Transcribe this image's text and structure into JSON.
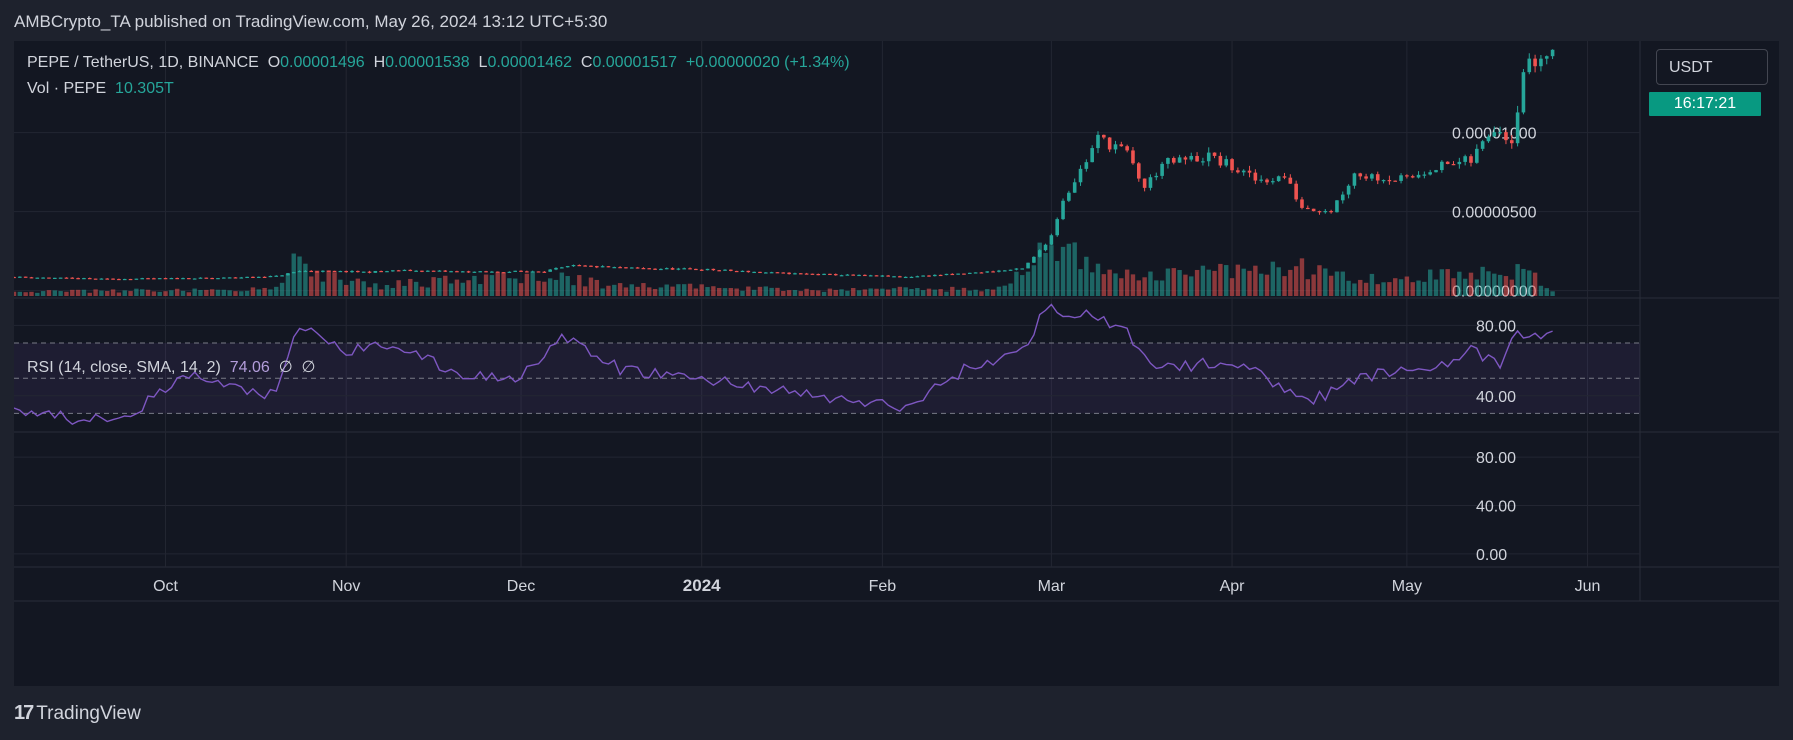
{
  "header": {
    "published": "AMBCrypto_TA published on TradingView.com, May 26, 2024 13:12 UTC+5:30"
  },
  "legend": {
    "symbol": "PEPE / TetherUS, 1D, BINANCE",
    "o_label": "O",
    "o_value": "0.00001496",
    "h_label": "H",
    "h_value": "0.00001538",
    "l_label": "L",
    "l_value": "0.00001462",
    "c_label": "C",
    "c_value": "0.00001517",
    "change": "+0.00000020 (+1.34%)",
    "vol_label": "Vol · PEPE",
    "vol_value": "10.305T",
    "rsi_label": "RSI (14, close, SMA, 14, 2)",
    "rsi_value": "74.06",
    "rsi_extra1": "∅",
    "rsi_extra2": "∅"
  },
  "price_scale": {
    "currency": "USDT",
    "countdown": "16:17:21"
  },
  "footer": {
    "brand": "TradingView"
  },
  "colors": {
    "up": "#26a69a",
    "down": "#ef5350",
    "rsi_line": "#7e57c2",
    "rsi_band": "#7e57c2",
    "text": "#d1d4dc",
    "grid": "#232632",
    "pane_border": "#2a2e39"
  },
  "chart_data": [
    {
      "type": "candlestick",
      "title": "PEPE / TetherUS, 1D, BINANCE",
      "x_ticks": [
        "Oct",
        "Nov",
        "Dec",
        "2024",
        "Feb",
        "Mar",
        "Apr",
        "May",
        "Jun"
      ],
      "y_ticks": [
        "0.00001000",
        "0.00000500",
        "0.00000000"
      ],
      "ylim": [
        -4e-07,
        1.58e-05
      ],
      "x_range": [
        "2023-09-05",
        "2024-06-10"
      ],
      "series": [
        {
          "name": "PEPE",
          "knots": [
            [
              "2023-09-05",
              8.7e-07
            ],
            [
              "2023-09-20",
              7.4e-07
            ],
            [
              "2023-10-10",
              8e-07
            ],
            [
              "2023-10-20",
              9.2e-07
            ],
            [
              "2023-10-24",
              1.25e-06
            ],
            [
              "2023-11-05",
              1.18e-06
            ],
            [
              "2023-11-10",
              1.28e-06
            ],
            [
              "2023-11-25",
              1.18e-06
            ],
            [
              "2023-12-05",
              1.25e-06
            ],
            [
              "2023-12-10",
              1.57e-06
            ],
            [
              "2023-12-20",
              1.42e-06
            ],
            [
              "2024-01-01",
              1.35e-06
            ],
            [
              "2024-01-15",
              1.1e-06
            ],
            [
              "2024-02-05",
              8.8e-07
            ],
            [
              "2024-02-15",
              1.08e-06
            ],
            [
              "2024-02-25",
              1.38e-06
            ],
            [
              "2024-02-27",
              2.1e-06
            ],
            [
              "2024-03-01",
              3.5e-06
            ],
            [
              "2024-03-03",
              5.8e-06
            ],
            [
              "2024-03-06",
              7.6e-06
            ],
            [
              "2024-03-09",
              9.6e-06
            ],
            [
              "2024-03-12",
              9.2e-06
            ],
            [
              "2024-03-14",
              8.6e-06
            ],
            [
              "2024-03-17",
              6.5e-06
            ],
            [
              "2024-03-20",
              8e-06
            ],
            [
              "2024-03-28",
              8.5e-06
            ],
            [
              "2024-04-01",
              7.8e-06
            ],
            [
              "2024-04-05",
              7e-06
            ],
            [
              "2024-04-10",
              7.2e-06
            ],
            [
              "2024-04-13",
              5.3e-06
            ],
            [
              "2024-04-18",
              5.1e-06
            ],
            [
              "2024-04-22",
              7.4e-06
            ],
            [
              "2024-05-01",
              7e-06
            ],
            [
              "2024-05-05",
              7.8e-06
            ],
            [
              "2024-05-12",
              8.2e-06
            ],
            [
              "2024-05-16",
              1.05e-05
            ],
            [
              "2024-05-19",
              9.6e-06
            ],
            [
              "2024-05-21",
              1.4e-05
            ],
            [
              "2024-05-24",
              1.47e-05
            ],
            [
              "2024-05-26",
              1.517e-05
            ]
          ]
        }
      ]
    },
    {
      "type": "bar",
      "title": "Vol · PEPE",
      "values_note": "volume bars scale relative to the pane",
      "knots": [
        [
          "2023-09-05",
          0.08
        ],
        [
          "2023-10-20",
          0.12
        ],
        [
          "2023-10-23",
          0.55
        ],
        [
          "2023-11-05",
          0.18
        ],
        [
          "2023-12-06",
          0.38
        ],
        [
          "2023-12-15",
          0.2
        ],
        [
          "2024-01-15",
          0.12
        ],
        [
          "2024-02-20",
          0.12
        ],
        [
          "2024-02-26",
          0.5
        ],
        [
          "2024-03-01",
          1.0
        ],
        [
          "2024-03-08",
          0.6
        ],
        [
          "2024-03-15",
          0.35
        ],
        [
          "2024-04-13",
          0.5
        ],
        [
          "2024-04-25",
          0.3
        ],
        [
          "2024-05-21",
          0.45
        ],
        [
          "2024-05-26",
          0.08
        ]
      ]
    },
    {
      "type": "line",
      "title": "RSI (14, close, SMA, 14, 2)",
      "y_ticks": [
        "80.00",
        "40.00"
      ],
      "ylim": [
        20,
        95
      ],
      "bands": [
        30,
        50,
        70
      ],
      "series": [
        {
          "name": "RSI",
          "knots": [
            [
              "2023-09-05",
              33
            ],
            [
              "2023-09-15",
              27
            ],
            [
              "2023-09-25",
              30
            ],
            [
              "2023-10-05",
              52
            ],
            [
              "2023-10-12",
              45
            ],
            [
              "2023-10-20",
              40
            ],
            [
              "2023-10-24",
              80
            ],
            [
              "2023-11-01",
              65
            ],
            [
              "2023-11-09",
              70
            ],
            [
              "2023-11-20",
              52
            ],
            [
              "2023-11-30",
              50
            ],
            [
              "2023-12-08",
              73
            ],
            [
              "2023-12-18",
              55
            ],
            [
              "2024-01-05",
              48
            ],
            [
              "2024-01-20",
              40
            ],
            [
              "2024-02-05",
              33
            ],
            [
              "2024-02-15",
              55
            ],
            [
              "2024-02-25",
              65
            ],
            [
              "2024-02-29",
              90
            ],
            [
              "2024-03-08",
              85
            ],
            [
              "2024-03-14",
              75
            ],
            [
              "2024-03-20",
              55
            ],
            [
              "2024-04-01",
              60
            ],
            [
              "2024-04-10",
              45
            ],
            [
              "2024-04-15",
              38
            ],
            [
              "2024-04-25",
              52
            ],
            [
              "2024-05-05",
              56
            ],
            [
              "2024-05-12",
              65
            ],
            [
              "2024-05-17",
              58
            ],
            [
              "2024-05-20",
              75
            ],
            [
              "2024-05-26",
              74.06
            ]
          ]
        }
      ]
    },
    {
      "type": "line",
      "title": "",
      "y_ticks": [
        "80.00",
        "40.00",
        "0.00"
      ],
      "ylim": [
        -10,
        100
      ],
      "series": []
    }
  ]
}
